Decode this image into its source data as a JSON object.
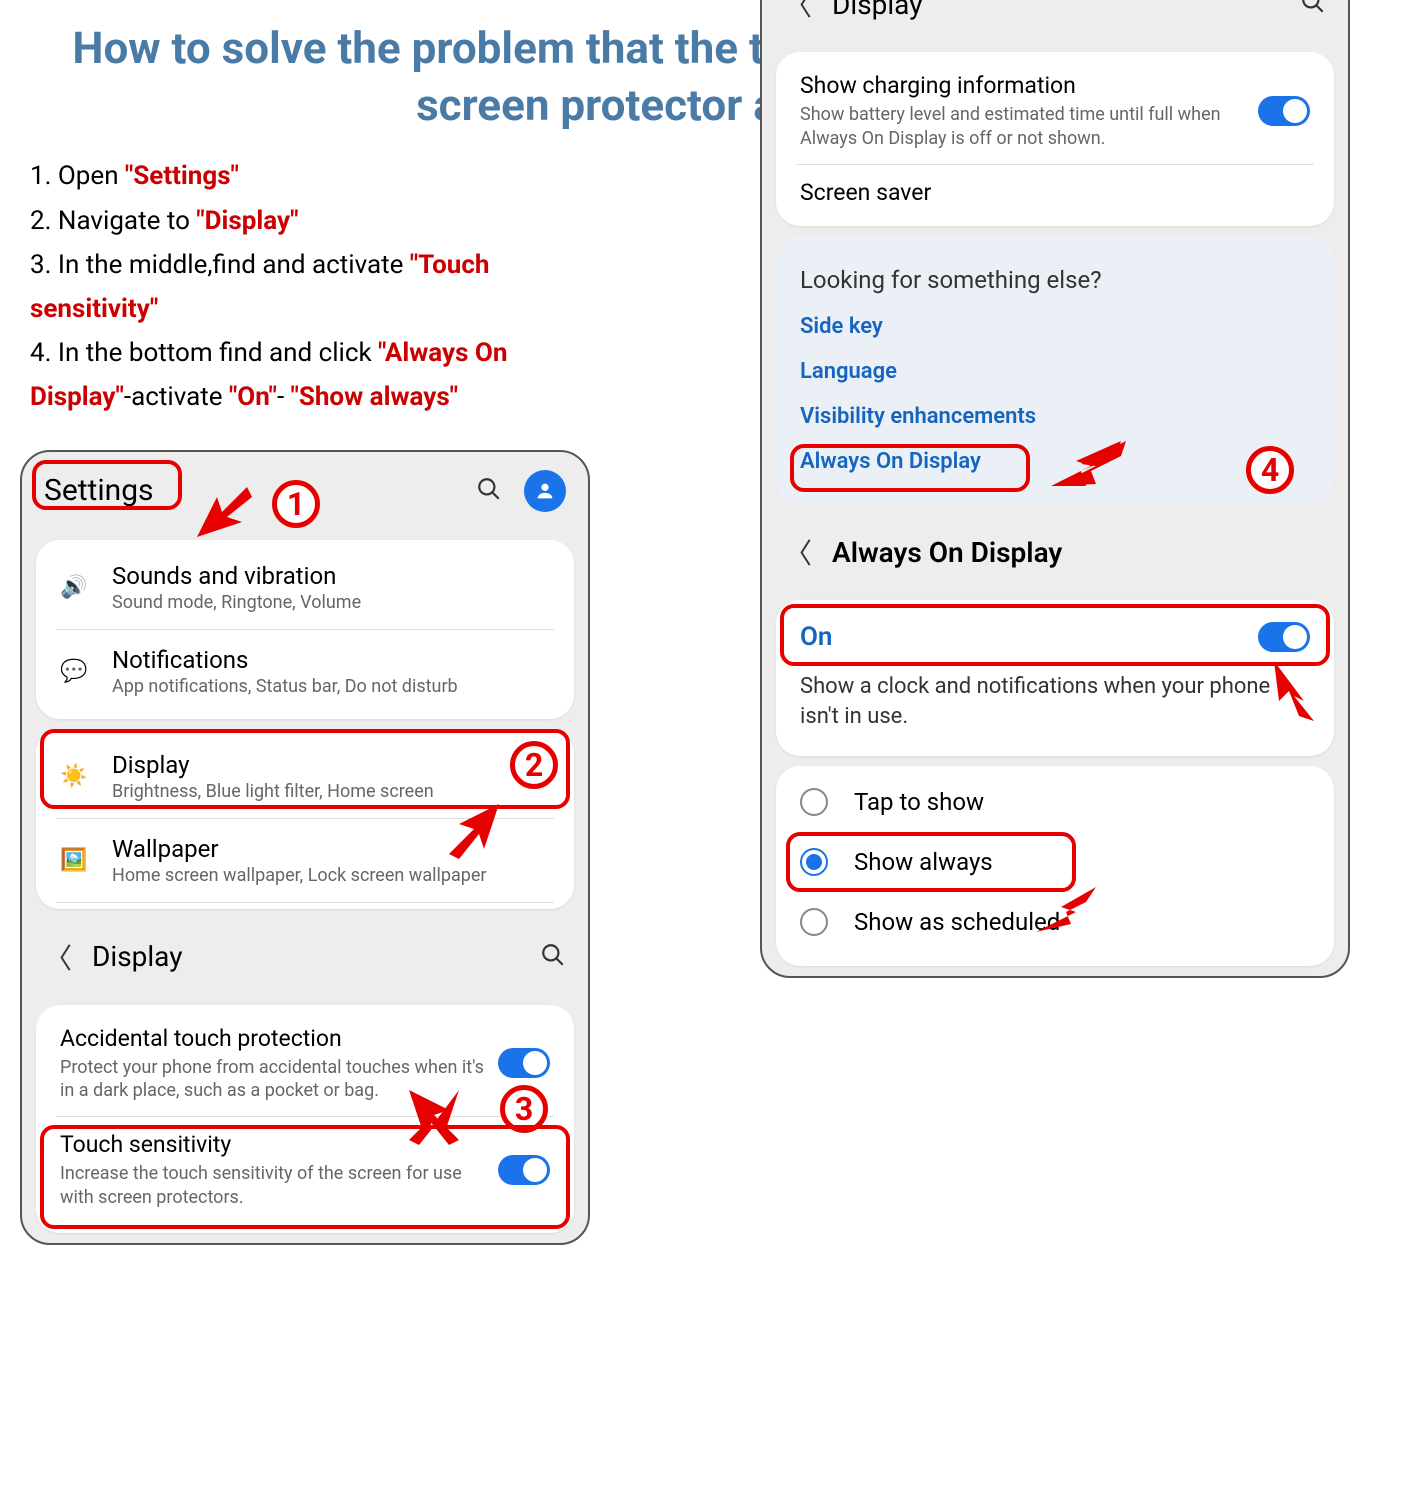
{
  "title": "How to solve the problem that the touch is not sensitive after  the screen protector application ?",
  "steps": {
    "s1_pre": "1. Open ",
    "s1_kw": "\"Settings\"",
    "s2_pre": "2. Navigate to ",
    "s2_kw": "\"Display\"",
    "s3_pre": "3. In the middle,find and activate ",
    "s3_kw": "\"Touch sensitivity\"",
    "s4_pre": "4. In the bottom find and click ",
    "s4_kw1": "\"Always On Display\"",
    "s4_mid": "-activate ",
    "s4_kw2": "\"On\"",
    "s4_mid2": "- ",
    "s4_kw3": "\"Show always\""
  },
  "callouts": {
    "c1": "1",
    "c2": "2",
    "c3": "3",
    "c4": "4"
  },
  "left": {
    "settings_title": "Settings",
    "items": [
      {
        "title": "Sounds and vibration",
        "sub": "Sound mode, Ringtone, Volume"
      },
      {
        "title": "Notifications",
        "sub": "App notifications, Status bar, Do not disturb"
      },
      {
        "title": "Display",
        "sub": "Brightness, Blue light filter, Home screen"
      },
      {
        "title": "Wallpaper",
        "sub": "Home screen wallpaper, Lock screen wallpaper"
      }
    ],
    "display_header": "Display",
    "accidental_title": "Accidental touch protection",
    "accidental_desc": "Protect your phone from accidental touches when it's in a dark place, such as a pocket or bag.",
    "touch_title": "Touch sensitivity",
    "touch_desc": "Increase the touch sensitivity of the screen for use with screen protectors."
  },
  "right": {
    "display_header": "Display",
    "charging_title": "Show charging information",
    "charging_desc": "Show battery level and estimated time until full when Always On Display is off or not shown.",
    "screensaver": "Screen saver",
    "looking_title": "Looking for something else?",
    "links": [
      "Side key",
      "Language",
      "Visibility enhancements",
      "Always On Display"
    ],
    "aod_header": "Always On Display",
    "on_label": "On",
    "on_desc": "Show a clock and notifications when your phone isn't in use.",
    "radios": [
      "Tap to show",
      "Show always",
      "Show as scheduled"
    ]
  }
}
